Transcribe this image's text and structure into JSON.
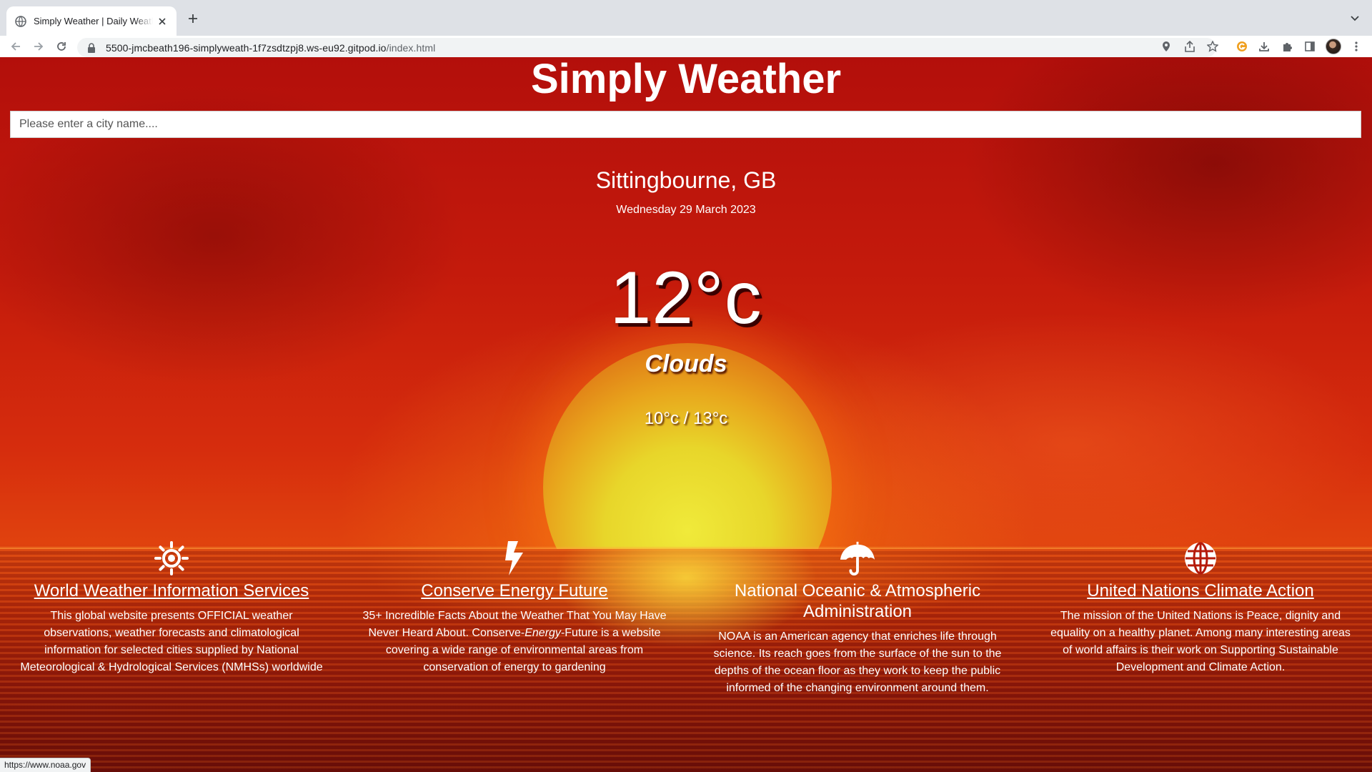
{
  "browser": {
    "tab_title": "Simply Weather | Daily Weather",
    "url_host": "5500-jmcbeath196-simplyweath-1f7zsdtzpj8.ws-eu92.gitpod.io",
    "url_path": "/index.html",
    "status_url": "https://www.noaa.gov"
  },
  "site": {
    "title": "Simply Weather",
    "search_placeholder": "Please enter a city name...."
  },
  "weather": {
    "city": "Sittingbourne, GB",
    "date": "Wednesday 29 March 2023",
    "temperature": "12°c",
    "condition": "Clouds",
    "min_max": "10°c / 13°c"
  },
  "resources": [
    {
      "icon": "sun-icon",
      "heading": "World Weather Information Services",
      "text": "This global website presents OFFICIAL weather observations, weather forecasts and climatological information for selected cities supplied by National Meteorological & Hydrological Services (NMHSs) worldwide"
    },
    {
      "icon": "lightning-bolt-icon",
      "heading": "Conserve Energy Future",
      "text_before": "35+ Incredible Facts About the Weather That You May Have Never Heard About. Conserve-",
      "text_emphasis": "Energy",
      "text_after": "-Future is a website covering a wide range of environmental areas from conservation of energy to gardening"
    },
    {
      "icon": "umbrella-icon",
      "heading": "National Oceanic & Atmospheric Administration",
      "text": "NOAA is an American agency that enriches life through science. Its reach goes from the surface of the sun to the depths of the ocean floor as they work to keep the public informed of the changing environment around them."
    },
    {
      "icon": "globe-icon",
      "heading": "United Nations Climate Action",
      "text": "The mission of the United Nations is Peace, dignity and equality on a healthy planet. Among many interesting areas of world affairs is their work on Supporting Sustainable Development and Climate Action."
    }
  ]
}
